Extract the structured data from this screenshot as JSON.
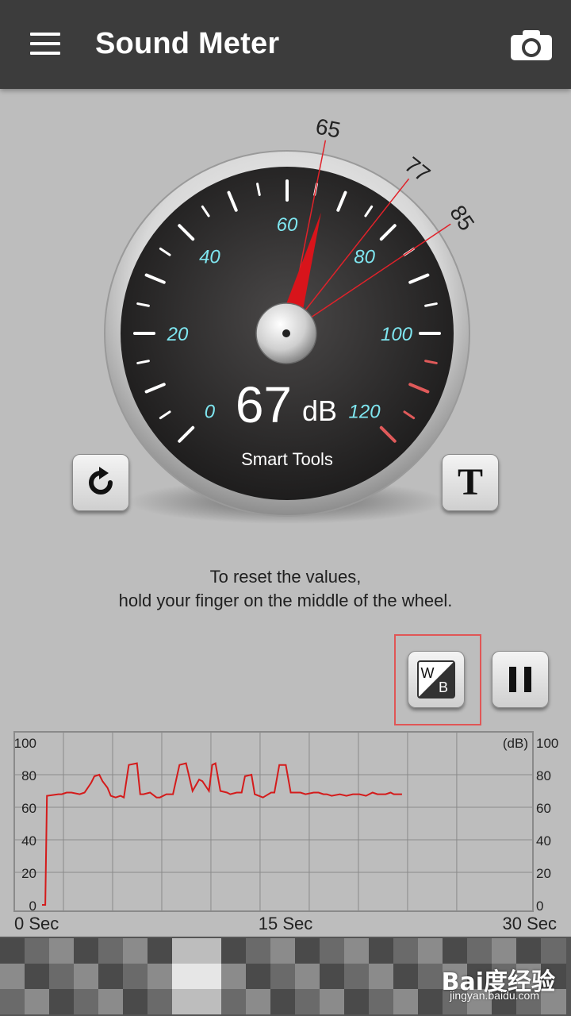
{
  "header": {
    "title": "Sound Meter",
    "menu_icon": "menu-icon",
    "camera_icon": "camera-icon"
  },
  "gauge": {
    "reading_value": "67",
    "reading_unit": "dB",
    "brand": "Smart Tools",
    "current_db": 67,
    "scale_min": 0,
    "scale_max": 120,
    "scale_labels": [
      "0",
      "20",
      "40",
      "60",
      "80",
      "100",
      "120"
    ],
    "markers": [
      {
        "label": "65",
        "value": 65
      },
      {
        "label": "77",
        "value": 77
      },
      {
        "label": "85",
        "value": 85
      }
    ],
    "colors": {
      "scale_label": "#7fe6f0",
      "needle": "#d8141b",
      "danger_ticks": "#e05a5a",
      "face": "#2b2a2a"
    }
  },
  "buttons": {
    "reset_icon": "refresh-icon",
    "text_label": "T",
    "wb_w": "W",
    "wb_b": "B",
    "pause_icon": "pause-icon"
  },
  "hint": {
    "line1": "To reset the values,",
    "line2": "hold your finger on the middle of the wheel."
  },
  "chart_data": {
    "type": "line",
    "unit_label": "(dB)",
    "x_tick_labels": [
      "0 Sec",
      "15 Sec",
      "30 Sec"
    ],
    "xlim": [
      0,
      30
    ],
    "ylim": [
      0,
      100
    ],
    "y_tick_labels": [
      "0",
      "20",
      "40",
      "60",
      "80",
      "100"
    ],
    "grid": true,
    "line_color": "#d41b1b",
    "series": [
      {
        "x": [
          0,
          0.2,
          0.3,
          1.0,
          1.2,
          1.5,
          1.8,
          2.3,
          2.6,
          3.0,
          3.2,
          3.5,
          3.7,
          4.0,
          4.2,
          4.5,
          4.8,
          5.0,
          5.3,
          5.8,
          6.0,
          6.2,
          6.6,
          7.0,
          7.2,
          7.6,
          8.0,
          8.4,
          8.8,
          9.2,
          9.6,
          9.8,
          10.2,
          10.4,
          10.6,
          10.9,
          11.3,
          11.5,
          11.9,
          12.2,
          12.4,
          12.8,
          13.0,
          13.5,
          14.0,
          14.2,
          14.5,
          14.9,
          15.2,
          15.8,
          16.1,
          16.6,
          16.9,
          17.2,
          17.4,
          17.7,
          18.2,
          18.6,
          19.0,
          19.4,
          19.8,
          20.2,
          20.5,
          20.8,
          21.0,
          21.3,
          21.5,
          21.7,
          22.0
        ],
        "y": [
          0,
          0,
          67,
          68,
          68,
          69,
          69,
          68,
          69,
          75,
          79,
          80,
          76,
          72,
          67,
          66,
          67,
          66,
          86,
          87,
          68,
          68,
          69,
          66,
          66,
          68,
          68,
          86,
          87,
          70,
          77,
          76,
          70,
          86,
          87,
          70,
          69,
          68,
          69,
          69,
          79,
          80,
          68,
          66,
          69,
          69,
          86,
          86,
          69,
          69,
          68,
          69,
          69,
          68,
          68,
          67,
          68,
          67,
          68,
          68,
          67,
          69,
          68,
          68,
          68,
          69,
          68,
          68,
          68
        ]
      }
    ]
  }
}
